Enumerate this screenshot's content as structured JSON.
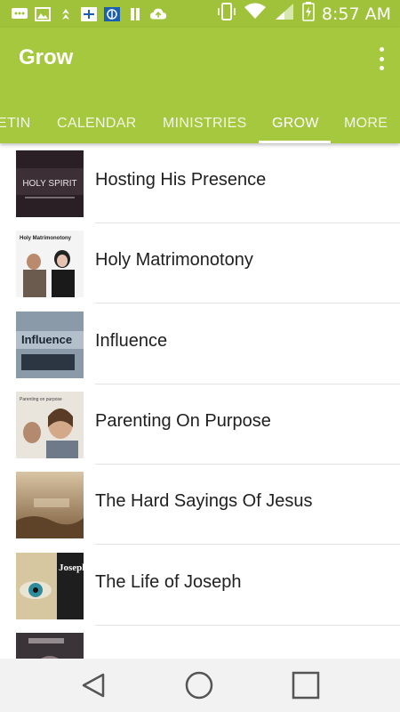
{
  "status_bar": {
    "time": "8:57 AM",
    "icons": [
      "message-icon",
      "image-icon",
      "app-icon",
      "app-icon",
      "app-icon",
      "app-icon",
      "cloud-upload-icon"
    ],
    "right_icons": [
      "vibrate-icon",
      "wifi-icon",
      "signal-icon",
      "battery-icon"
    ]
  },
  "app_bar": {
    "title": "Grow",
    "menu_icon": "more-vert-icon",
    "tabs": [
      {
        "label": "ETIN",
        "active": false
      },
      {
        "label": "CALENDAR",
        "active": false
      },
      {
        "label": "MINISTRIES",
        "active": false
      },
      {
        "label": "GROW",
        "active": true
      },
      {
        "label": "MORE",
        "active": false
      }
    ]
  },
  "list": {
    "items": [
      {
        "title": "Hosting His Presence",
        "thumb_text": "HOLY SPIRIT"
      },
      {
        "title": "Holy Matrimonotony",
        "thumb_text": "Holy Matrimonotony"
      },
      {
        "title": "Influence",
        "thumb_text": "Influence"
      },
      {
        "title": "Parenting On Purpose",
        "thumb_text": "Parenting on purpose"
      },
      {
        "title": "The Hard Sayings Of Jesus",
        "thumb_text": ""
      },
      {
        "title": "The Life of Joseph",
        "thumb_text": "Joseph"
      },
      {
        "title": "",
        "thumb_text": ""
      }
    ]
  },
  "nav_bar": {
    "buttons": [
      "back-icon",
      "home-icon",
      "recents-icon"
    ]
  },
  "colors": {
    "primary": "#a6c83f",
    "status_bar": "#9fc23a"
  }
}
